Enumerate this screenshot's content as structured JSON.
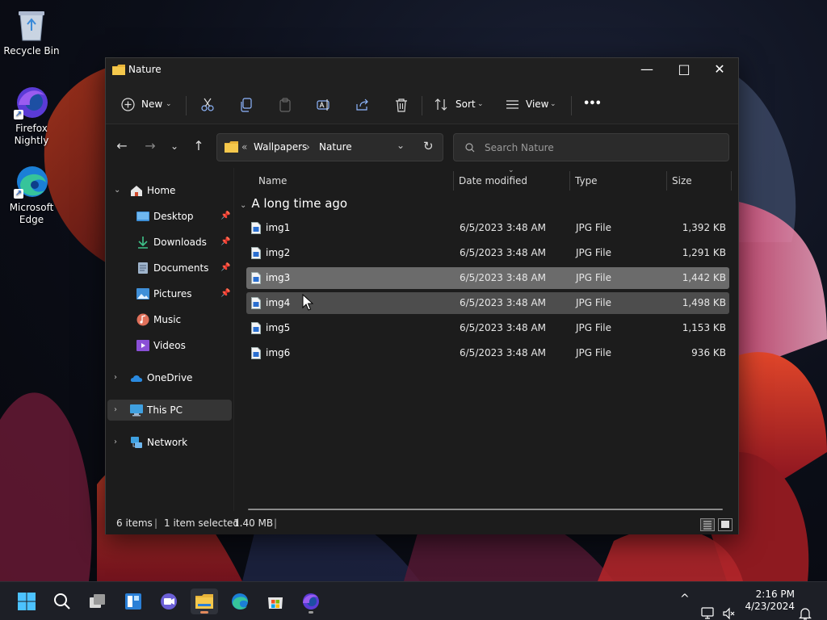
{
  "desktop": {
    "icons": [
      {
        "label": "Recycle Bin",
        "icon": "recycle-bin-icon"
      },
      {
        "label": "Firefox Nightly",
        "icon": "firefox-nightly-icon"
      },
      {
        "label": "Microsoft Edge",
        "icon": "edge-icon"
      }
    ]
  },
  "window": {
    "title": "Nature",
    "controls": {
      "minimize": "—",
      "maximize": "□",
      "close": "✕"
    }
  },
  "toolbar": {
    "new_label": "New",
    "sort_label": "Sort",
    "view_label": "View",
    "more_label": "•••",
    "icons": [
      "cut-icon",
      "copy-icon",
      "paste-icon",
      "rename-icon",
      "share-icon",
      "delete-icon"
    ]
  },
  "address": {
    "overflow": "«",
    "crumbs": [
      "Wallpapers",
      "Nature"
    ],
    "separator": "›"
  },
  "search": {
    "placeholder": "Search Nature"
  },
  "nav": {
    "home": "Home",
    "quick_access": [
      {
        "label": "Desktop",
        "pinned": true
      },
      {
        "label": "Downloads",
        "pinned": true
      },
      {
        "label": "Documents",
        "pinned": true
      },
      {
        "label": "Pictures",
        "pinned": true
      },
      {
        "label": "Music",
        "pinned": false
      },
      {
        "label": "Videos",
        "pinned": false
      }
    ],
    "onedrive": "OneDrive",
    "thispc": "This PC",
    "network": "Network",
    "selected": "This PC"
  },
  "columns": {
    "name": "Name",
    "date": "Date modified",
    "type": "Type",
    "size": "Size"
  },
  "group": {
    "label": "A long time ago"
  },
  "files": [
    {
      "name": "img1",
      "date": "6/5/2023 3:48 AM",
      "type": "JPG File",
      "size": "1,392 KB",
      "state": ""
    },
    {
      "name": "img2",
      "date": "6/5/2023 3:48 AM",
      "type": "JPG File",
      "size": "1,291 KB",
      "state": ""
    },
    {
      "name": "img3",
      "date": "6/5/2023 3:48 AM",
      "type": "JPG File",
      "size": "1,442 KB",
      "state": "selected"
    },
    {
      "name": "img4",
      "date": "6/5/2023 3:48 AM",
      "type": "JPG File",
      "size": "1,498 KB",
      "state": "hover"
    },
    {
      "name": "img5",
      "date": "6/5/2023 3:48 AM",
      "type": "JPG File",
      "size": "1,153 KB",
      "state": ""
    },
    {
      "name": "img6",
      "date": "6/5/2023 3:48 AM",
      "type": "JPG File",
      "size": "936 KB",
      "state": ""
    }
  ],
  "status": {
    "count": "6 items",
    "selection": "1 item selected",
    "size": "1.40 MB",
    "divider": "|"
  },
  "taskbar": {
    "apps": [
      "start-icon",
      "search-icon",
      "task-view-icon",
      "widgets-icon",
      "teams-chat-icon",
      "file-explorer-icon",
      "edge-icon",
      "store-icon",
      "firefox-nightly-icon"
    ],
    "clock_time": "2:16 PM",
    "clock_date": "4/23/2024",
    "tray_chevron": "^"
  },
  "colors": {
    "accent_folder": "#f2c94c",
    "selected_row": "#6b6b6b",
    "window_bg": "#1c1c1c"
  }
}
